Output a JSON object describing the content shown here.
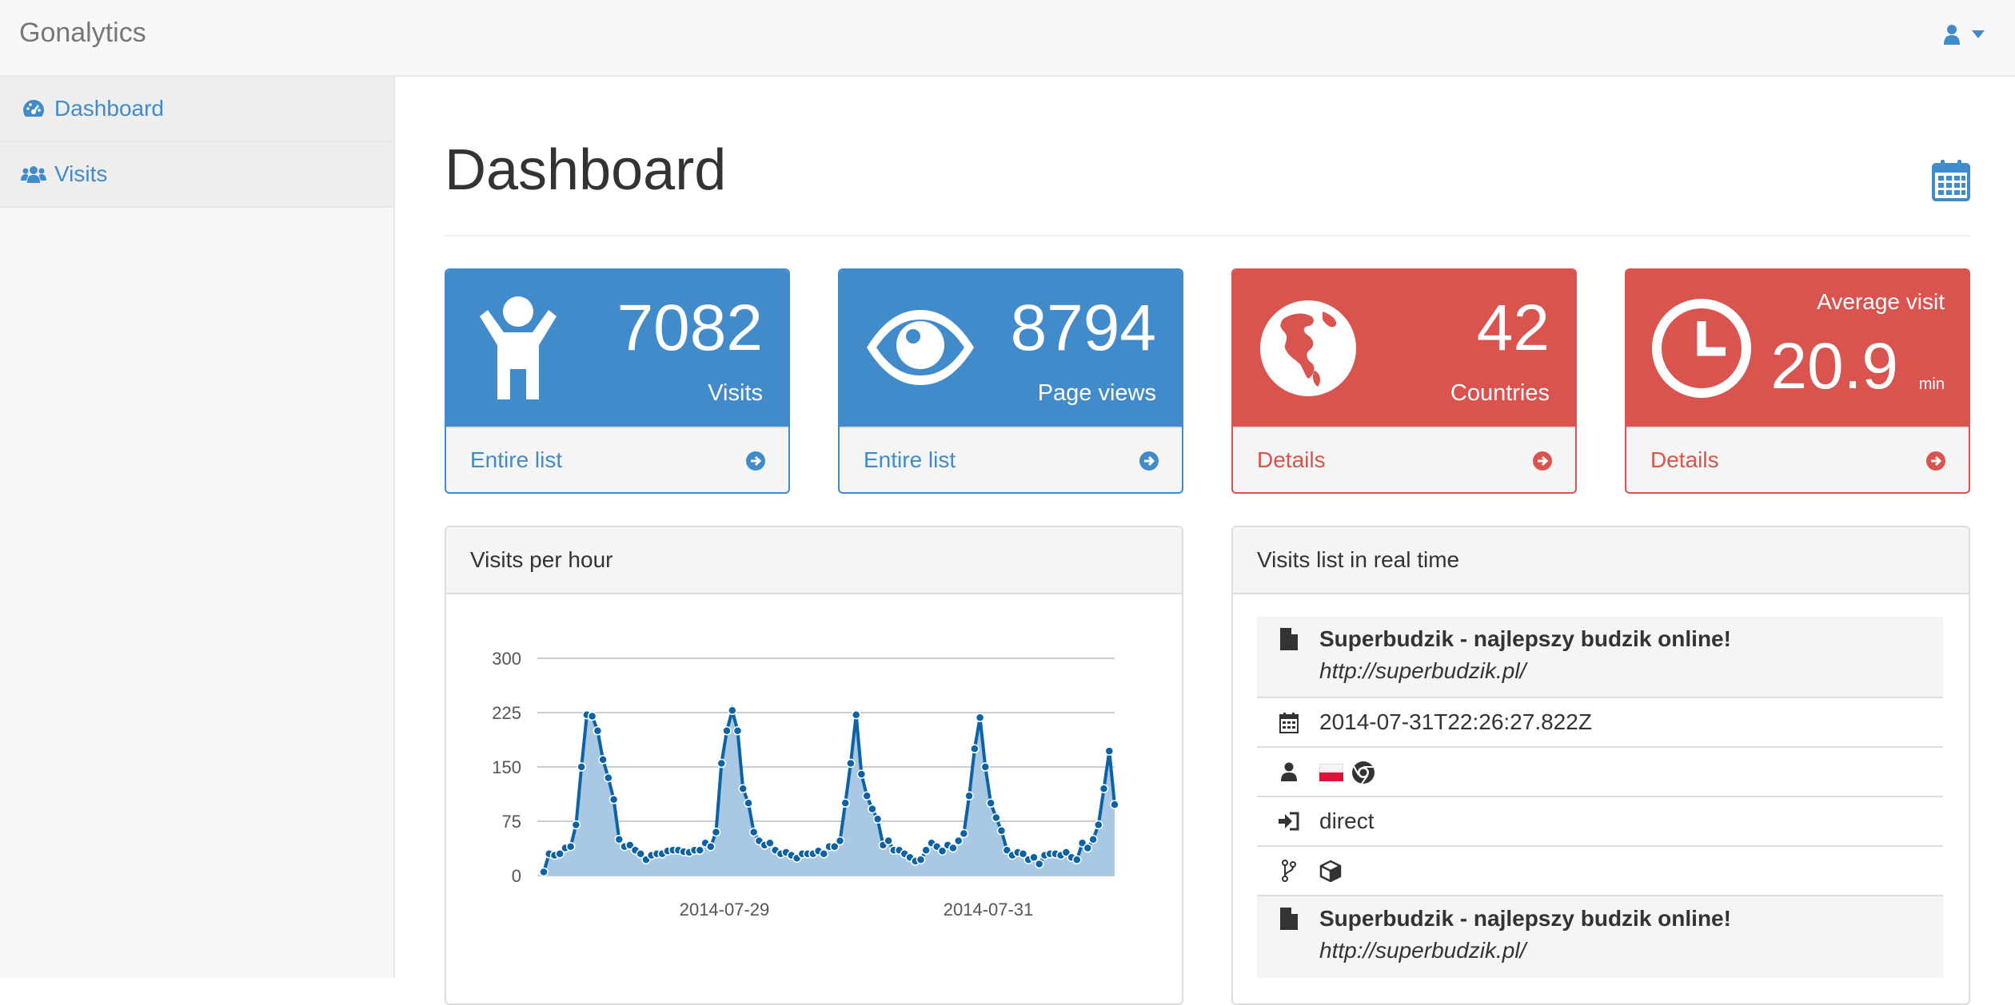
{
  "app": {
    "brand": "Gonalytics"
  },
  "nav": {
    "user_icon": "user-icon",
    "caret_icon": "caret-down-icon"
  },
  "sidebar": {
    "items": [
      {
        "label": "Dashboard",
        "icon": "dashboard-icon",
        "active": true
      },
      {
        "label": "Visits",
        "icon": "users-icon",
        "active": false
      }
    ]
  },
  "page": {
    "title": "Dashboard",
    "calendar_icon": "calendar-icon"
  },
  "stats": [
    {
      "value": "7082",
      "label": "Visits",
      "link": "Entire list",
      "icon": "child-icon",
      "color": "#428bca"
    },
    {
      "value": "8794",
      "label": "Page views",
      "link": "Entire list",
      "icon": "eye-icon",
      "color": "#428bca"
    },
    {
      "value": "42",
      "label": "Countries",
      "link": "Details",
      "icon": "globe-icon",
      "color": "#d9534f"
    },
    {
      "top": "Average visit",
      "value": "20.9",
      "unit": "min",
      "link": "Details",
      "icon": "clock-icon",
      "color": "#d9534f"
    }
  ],
  "chart_panel": {
    "title": "Visits per hour"
  },
  "chart_data": {
    "type": "area",
    "title": "",
    "ylim": [
      0,
      300
    ],
    "yticks": [
      "300",
      "225",
      "150",
      "75",
      "0"
    ],
    "xtick_labels": [
      "2014-07-29",
      "2014-07-31"
    ],
    "grid": true,
    "colors": {
      "line": "#0b62a4",
      "fill": "#a8c8e4"
    },
    "values": [
      5,
      30,
      28,
      30,
      38,
      40,
      70,
      150,
      222,
      220,
      200,
      160,
      135,
      105,
      50,
      40,
      42,
      35,
      30,
      22,
      28,
      30,
      30,
      34,
      35,
      35,
      33,
      32,
      35,
      35,
      45,
      40,
      60,
      155,
      200,
      228,
      200,
      120,
      100,
      60,
      48,
      42,
      45,
      35,
      30,
      32,
      28,
      24,
      30,
      30,
      30,
      34,
      30,
      40,
      40,
      48,
      100,
      155,
      222,
      140,
      110,
      92,
      78,
      42,
      48,
      35,
      35,
      30,
      25,
      20,
      22,
      35,
      45,
      40,
      34,
      42,
      38,
      48,
      58,
      110,
      175,
      218,
      150,
      100,
      80,
      62,
      35,
      28,
      32,
      30,
      22,
      25,
      16,
      28,
      30,
      30,
      28,
      32,
      25,
      22,
      45,
      38,
      50,
      70,
      120,
      172,
      98
    ]
  },
  "visits_panel": {
    "title": "Visits list in real time",
    "rows": [
      {
        "kind": "page",
        "icon": "file-icon",
        "title": "Superbudzik - najlepszy budzik online!",
        "url": "http://superbudzik.pl/"
      },
      {
        "kind": "text",
        "icon": "calendar-icon",
        "text": "2014-07-31T22:26:27.822Z"
      },
      {
        "kind": "user",
        "icon": "user-icon",
        "flag": "poland-flag-icon",
        "browser": "chrome-icon"
      },
      {
        "kind": "text",
        "icon": "sign-in-icon",
        "text": "direct"
      },
      {
        "kind": "fork",
        "icon": "code-fork-icon",
        "extra": "cube-icon"
      },
      {
        "kind": "page",
        "icon": "file-icon",
        "title": "Superbudzik - najlepszy budzik online!",
        "url": "http://superbudzik.pl/"
      }
    ]
  }
}
